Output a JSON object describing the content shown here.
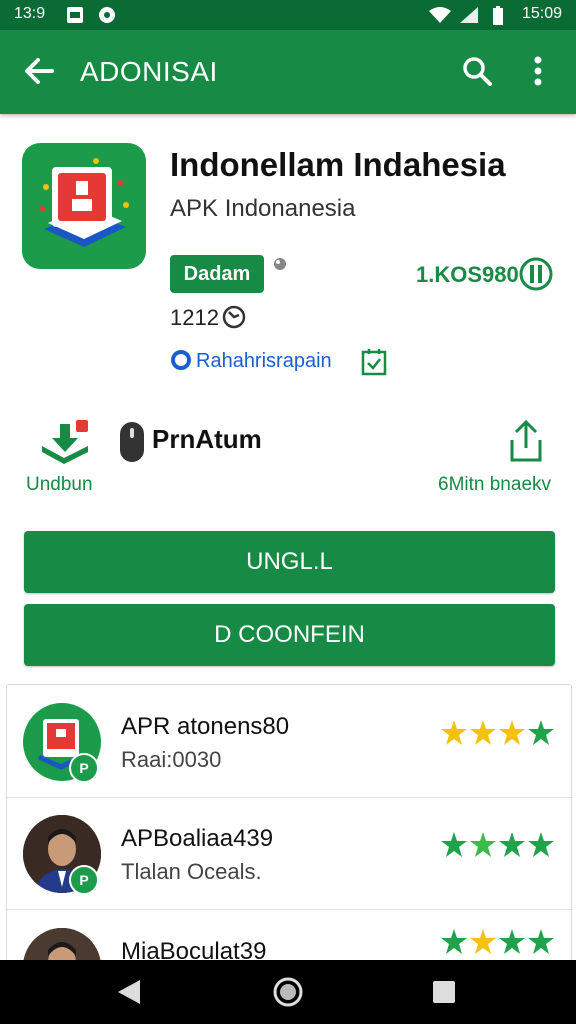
{
  "status_bar": {
    "time_left": "13:9",
    "time_right": "15:09"
  },
  "app_bar": {
    "title": "ADONISAI"
  },
  "app": {
    "title": "Indonellam Indahesia",
    "developer": "APK Indonanesia",
    "badge": "Dadam",
    "downloads": "1.KOS980",
    "version": "1212",
    "link_label": "Rahahrisrapain"
  },
  "actions": {
    "uninstall_label": "Undbun",
    "premium_label": "PrnAtum",
    "share_label": "6Mitn bnaekv"
  },
  "buttons": {
    "primary": "UNGL.L",
    "secondary": "D COONFEIN"
  },
  "list": [
    {
      "title": "APR atonens80",
      "subtitle": "Raai:0030",
      "rating": 4
    },
    {
      "title": "APBoaliaa439",
      "subtitle": "Tlalan Oceals.",
      "rating": 4
    },
    {
      "title": "MiaBoculat39",
      "subtitle": "",
      "rating": 4
    }
  ],
  "colors": {
    "primary_green": "#178a45",
    "status_green": "#0a6b34",
    "star_yellow": "#f4c20d",
    "star_green": "#1fa24a",
    "link_blue": "#1a5fd0"
  }
}
